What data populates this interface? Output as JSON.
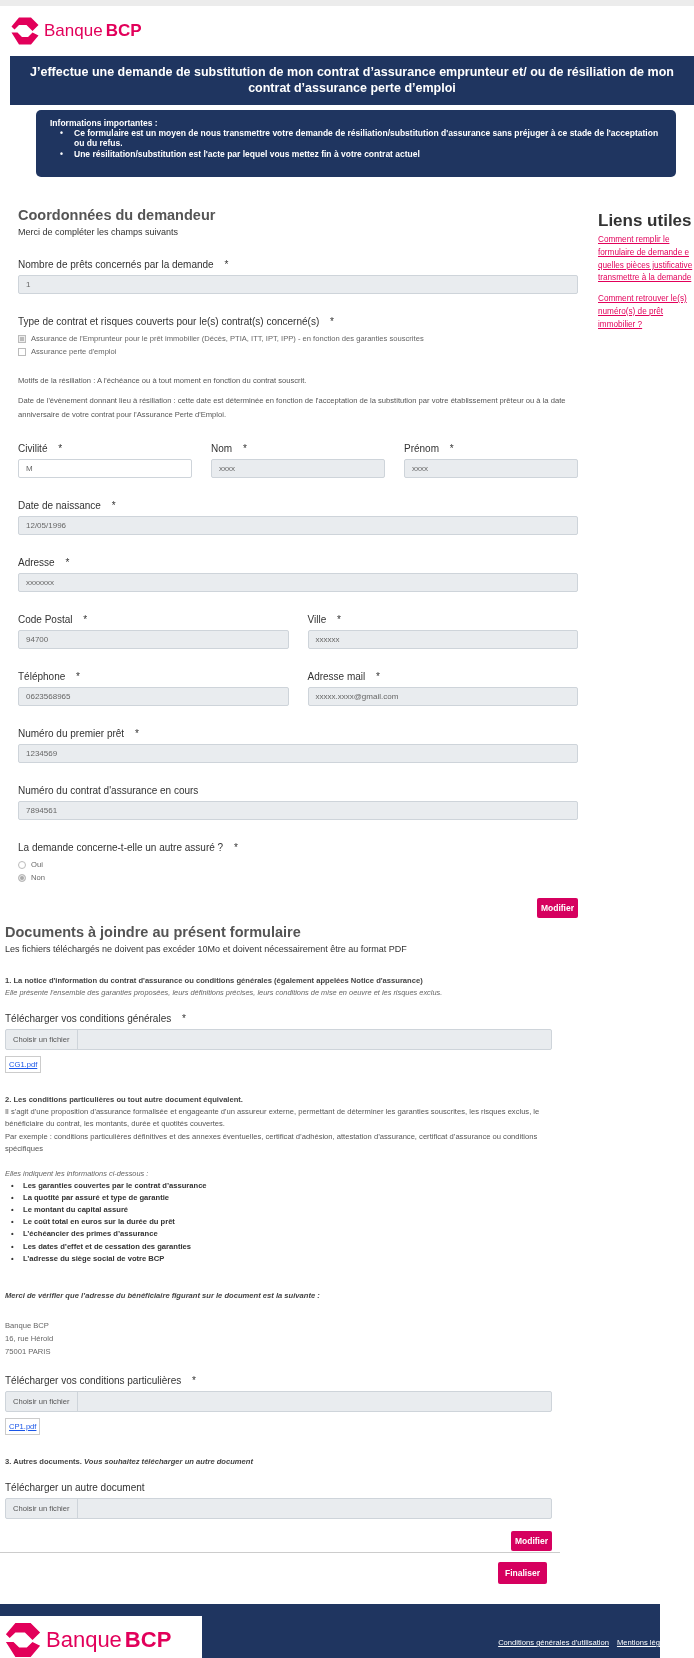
{
  "header": {
    "logo": {
      "name": "Banque",
      "brand": "BCP"
    }
  },
  "banner": {
    "title": "J’effectue une demande de substitution de mon contrat d’assurance emprunteur et/ ou de résiliation de mon contrat d’assurance perte d’emploi"
  },
  "info_box": {
    "title": "Informations importantes :",
    "bullet": "•",
    "items": [
      "Ce formulaire est un moyen de nous transmettre votre demande de résiliation/substitution d'assurance sans préjuger à ce stade de l'acceptation ou du refus.",
      "Une résilitation/substitution est l'acte par lequel vous mettez fin à votre contrat actuel"
    ]
  },
  "applicant": {
    "title": "Coordonnées du demandeur",
    "subtitle": "Merci de compléter les champs suivants",
    "blocks": [
      {
        "kind": "fields",
        "fields": [
          {
            "label": "Nombre de prêts concernés par la demande",
            "required_mark": "*",
            "value": "1",
            "disabled": true
          }
        ]
      },
      {
        "kind": "checkboxes",
        "label": "Type de contrat et risques couverts pour le(s) contrat(s) concerné(s)",
        "required_mark": "*",
        "options": [
          {
            "label": "Assurance de l'Emprunteur pour le prêt immobilier (Décès, PTIA, ITT, IPT, IPP) - en fonction des garanties souscrites",
            "checked": true
          },
          {
            "label": "Assurance perte d'emploi",
            "checked": false
          }
        ]
      },
      {
        "kind": "note",
        "text": "Motifs de la résiliation : A l'échéance ou à tout moment en fonction du contrat souscrit."
      },
      {
        "kind": "note",
        "text": "Date de l'évènement donnant lieu à résiliation : cette date est déterminée en fonction de l'acceptation de la substitution par votre établissement prêteur ou à la date anniversaire de votre contrat pour l'Assurance Perte d'Emploi."
      },
      {
        "kind": "fields",
        "fields": [
          {
            "label": "Civilité",
            "required_mark": "*",
            "value": "M",
            "disabled": false
          },
          {
            "label": "Nom",
            "required_mark": "*",
            "value": "xxxx",
            "disabled": true
          },
          {
            "label": "Prénom",
            "required_mark": "*",
            "value": "xxxx",
            "disabled": true
          }
        ]
      },
      {
        "kind": "fields",
        "fields": [
          {
            "label": "Date de naissance",
            "required_mark": "*",
            "value": "12/05/1996",
            "disabled": true
          }
        ]
      },
      {
        "kind": "fields",
        "fields": [
          {
            "label": "Adresse",
            "required_mark": "*",
            "value": "xxxxxxx",
            "disabled": true
          }
        ]
      },
      {
        "kind": "fields",
        "fields": [
          {
            "label": "Code Postal",
            "required_mark": "*",
            "value": "94700",
            "disabled": true
          },
          {
            "label": "Ville",
            "required_mark": "*",
            "value": "xxxxxx",
            "disabled": true
          }
        ]
      },
      {
        "kind": "fields",
        "fields": [
          {
            "label": "Téléphone",
            "required_mark": "*",
            "value": "0623568965",
            "disabled": true
          },
          {
            "label": "Adresse mail",
            "required_mark": "*",
            "value": "xxxxx.xxxx@gmail.com",
            "disabled": true
          }
        ]
      },
      {
        "kind": "fields",
        "fields": [
          {
            "label": "Numéro du premier prêt",
            "required_mark": "*",
            "value": "1234569",
            "disabled": true
          }
        ]
      },
      {
        "kind": "fields",
        "fields": [
          {
            "label": "Numéro du contrat d'assurance en cours",
            "value": "7894561",
            "disabled": true
          }
        ]
      },
      {
        "kind": "radios",
        "label": "La demande concerne-t-elle un autre assuré ?",
        "required_mark": "*",
        "options": [
          {
            "label": "Oui",
            "selected": false
          },
          {
            "label": "Non",
            "selected": true
          }
        ]
      }
    ],
    "button": "Modifier"
  },
  "sidebar": {
    "title": "Liens utiles",
    "links": [
      {
        "lines": [
          "Comment remplir le",
          "formulaire de demande e",
          "quelles pièces justificative",
          "transmettre à la demande"
        ]
      },
      {
        "lines": [
          "Comment retrouver le(s)",
          "numéro(s) de prêt",
          "immobilier ?"
        ]
      }
    ]
  },
  "documents": {
    "title": "Documents à joindre au présent formulaire",
    "subtitle": "Les fichiers téléchargés ne doivent pas excéder 10Mo et doivent nécessairement être au format PDF",
    "blocks": [
      {
        "kind": "heading",
        "text": "1. La notice d'information du contrat d'assurance ou conditions générales (également appelées Notice d'assurance)"
      },
      {
        "kind": "italic",
        "text": "Elle présente l'ensemble des garanties proposées, leurs définitions précises, leurs conditions de mise en oeuvre et les risques exclus."
      },
      {
        "kind": "file",
        "label": "Télécharger vos conditions générales",
        "required_mark": "*",
        "button": "Choisir un fichier",
        "file": "CG1.pdf"
      },
      {
        "kind": "heading",
        "text": "2. Les conditions particulières ou tout autre document équivalent."
      },
      {
        "kind": "paragraph",
        "text": "Il s'agit d'une proposition d'assurance formalisée et engageante d'un assureur externe, permettant de déterminer les garanties souscrites, les risques exclus, le bénéficiaire du contrat, les montants, durée et quotités couvertes."
      },
      {
        "kind": "paragraph",
        "text": "Par exemple : conditions particulières définitives et des annexes éventuelles, certificat d’adhésion, attestation d’assurance, certificat d’assurance ou conditions spécifiques"
      },
      {
        "kind": "italic",
        "text": "Elles indiquent les informations ci-dessous :"
      },
      {
        "kind": "list",
        "bullet": "•",
        "items": [
          "Les garanties couvertes par le contrat d’assurance",
          "La quotité par assuré et type de garantie",
          "Le montant du capital assuré",
          "Le coût total en euros sur la durée du prêt",
          "L’échéancier des primes d’assurance",
          "Les dates d’effet et de cessation des garanties",
          "L’adresse du siège social de votre BCP"
        ]
      },
      {
        "kind": "notice",
        "text": "Merci de vérifier que l’adresse du bénéficiaire figurant sur le document est la suivante :"
      },
      {
        "kind": "address",
        "lines": [
          "Banque BCP",
          "16, rue Hérold",
          "75001 PARIS"
        ]
      },
      {
        "kind": "file",
        "label": "Télécharger vos conditions particulières",
        "required_mark": "*",
        "button": "Choisir un fichier",
        "file": "CP1.pdf"
      },
      {
        "kind": "heading",
        "text": "**3. Autres documents.** *Vous souhaitez télécharger un autre document*"
      },
      {
        "kind": "file",
        "label": "Télécharger un autre document",
        "button": "Choisir un fichier"
      }
    ],
    "button": "Modifier"
  },
  "submit": "Finaliser",
  "footer": {
    "logo": {
      "name": "Banque",
      "brand": "BCP"
    },
    "links": [
      "Conditions générales d'utilisation",
      "Mentions lég"
    ]
  }
}
